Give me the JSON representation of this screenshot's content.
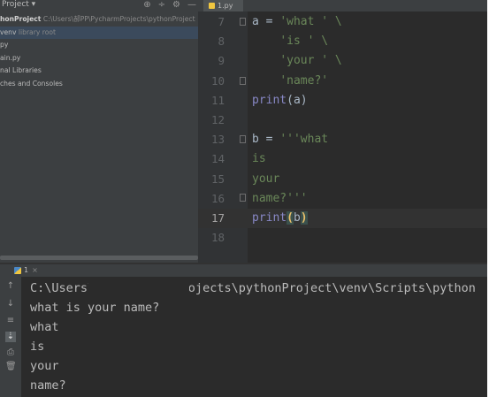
{
  "project_panel": {
    "title": "Project ▾",
    "toolbar_icons": [
      "⊕",
      "÷",
      "⚙",
      "—"
    ],
    "tree": [
      {
        "prefix": "honProject",
        "text": " C:\\Users\\郝PP\\PycharmProjects\\pythonProject",
        "bold_prefix": true,
        "selected": false
      },
      {
        "prefix": "venv",
        "text": " library root",
        "bold_prefix": false,
        "selected": true
      },
      {
        "prefix": "py",
        "text": "",
        "bold_prefix": false,
        "selected": false
      },
      {
        "prefix": "ain.py",
        "text": "",
        "bold_prefix": false,
        "selected": false
      },
      {
        "prefix": "nal Libraries",
        "text": "",
        "bold_prefix": false,
        "selected": false
      },
      {
        "prefix": "ches and Consoles",
        "text": "",
        "bold_prefix": false,
        "selected": false
      }
    ]
  },
  "editor": {
    "tab_label": "1.py",
    "line_numbers": [
      "7",
      "8",
      "9",
      "10",
      "11",
      "12",
      "13",
      "14",
      "15",
      "16",
      "17",
      "18"
    ],
    "current_line": "17",
    "lines": [
      [
        {
          "t": "a = ",
          "c": "plain"
        },
        {
          "t": "'what ' \\",
          "c": "str"
        }
      ],
      [
        {
          "t": "    ",
          "c": "plain"
        },
        {
          "t": "'is ' \\",
          "c": "str"
        }
      ],
      [
        {
          "t": "    ",
          "c": "plain"
        },
        {
          "t": "'your ' \\",
          "c": "str"
        }
      ],
      [
        {
          "t": "    ",
          "c": "plain"
        },
        {
          "t": "'name?'",
          "c": "str"
        }
      ],
      [
        {
          "t": "print",
          "c": "fn"
        },
        {
          "t": "(a)",
          "c": "plain"
        }
      ],
      [],
      [
        {
          "t": "b = ",
          "c": "plain"
        },
        {
          "t": "'''what",
          "c": "str"
        }
      ],
      [
        {
          "t": "is",
          "c": "str"
        }
      ],
      [
        {
          "t": "your",
          "c": "str"
        }
      ],
      [
        {
          "t": "name?'''",
          "c": "str"
        }
      ],
      [
        {
          "t": "print",
          "c": "fn"
        },
        {
          "t": "(",
          "c": "paren"
        },
        {
          "t": "b",
          "c": "plain"
        },
        {
          "t": ")",
          "c": "paren"
        }
      ],
      []
    ]
  },
  "run_panel": {
    "tab_label": "1",
    "close": "×",
    "console_lines": [
      "C:\\Users\\          mProjects\\pythonProject\\venv\\Scripts\\python",
      "what is your name?",
      "what",
      "is",
      "your",
      "name?"
    ],
    "tools": [
      "↑",
      "↓",
      "≡",
      "⇣",
      "⎙",
      "🗑"
    ]
  },
  "colors": {
    "bg": "#2b2b2b",
    "panel": "#3c3f41",
    "string": "#6a8759",
    "builtin": "#8888c6",
    "text": "#a9b7c6",
    "paren_match": "#e8bf6a"
  }
}
